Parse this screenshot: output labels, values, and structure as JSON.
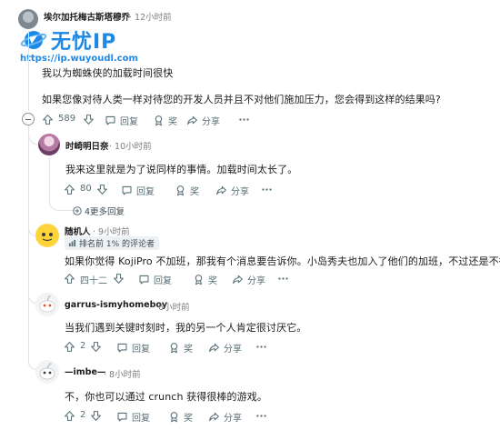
{
  "watermark": {
    "title": "无忧IP",
    "url": "https://ip.wuyoudl.com"
  },
  "top_comment": {
    "username": "埃尔加托梅古斯塔穆乔",
    "time": "12小时前",
    "lines": [
      "我以为蜘蛛侠的加载时间很快",
      "如果您像对待人类一样对待您的开发人员并且不对他们施加压力，您会得到这样的结果吗?"
    ],
    "votes": "589",
    "reply_label": "回复",
    "award_label": "奖",
    "share_label": "分享"
  },
  "replies": [
    {
      "username": "时崎明日奈",
      "time": "10小时前",
      "text": "我来这里就是为了说同样的事情。加载时间太长了。",
      "votes": "80",
      "reply_label": "回复",
      "award_label": "奖",
      "share_label": "分享",
      "more_replies": "4更多回复"
    },
    {
      "username": "随机人",
      "time": "9小时前",
      "badge": "排名前 1% 的评论者",
      "text": "如果你觉得 KojiPro 不加班，那我有个消息要告诉你。小岛秀夫也加入了他们的加班，不过还是不行。",
      "votes": "四十二",
      "reply_label": "回复",
      "award_label": "奖",
      "share_label": "分享"
    },
    {
      "username": "garrus-ismyhomeboy",
      "time": "6小时前",
      "text": "当我们遇到关键时刻时，我的另一个人肯定很讨厌它。",
      "votes": "2",
      "reply_label": "回复",
      "award_label": "奖",
      "share_label": "分享"
    },
    {
      "username": "—imbe—",
      "time": "8小时前",
      "text": "不，你也可以通过 crunch 获得很棒的游戏。",
      "votes": "2",
      "reply_label": "回复",
      "award_label": "奖",
      "share_label": "分享"
    }
  ],
  "colors": {
    "text": "#1c1c1c",
    "meta": "#7c7c83",
    "action": "#576f76",
    "thread": "#e0e3e6",
    "watermark": "#1e88e5"
  }
}
